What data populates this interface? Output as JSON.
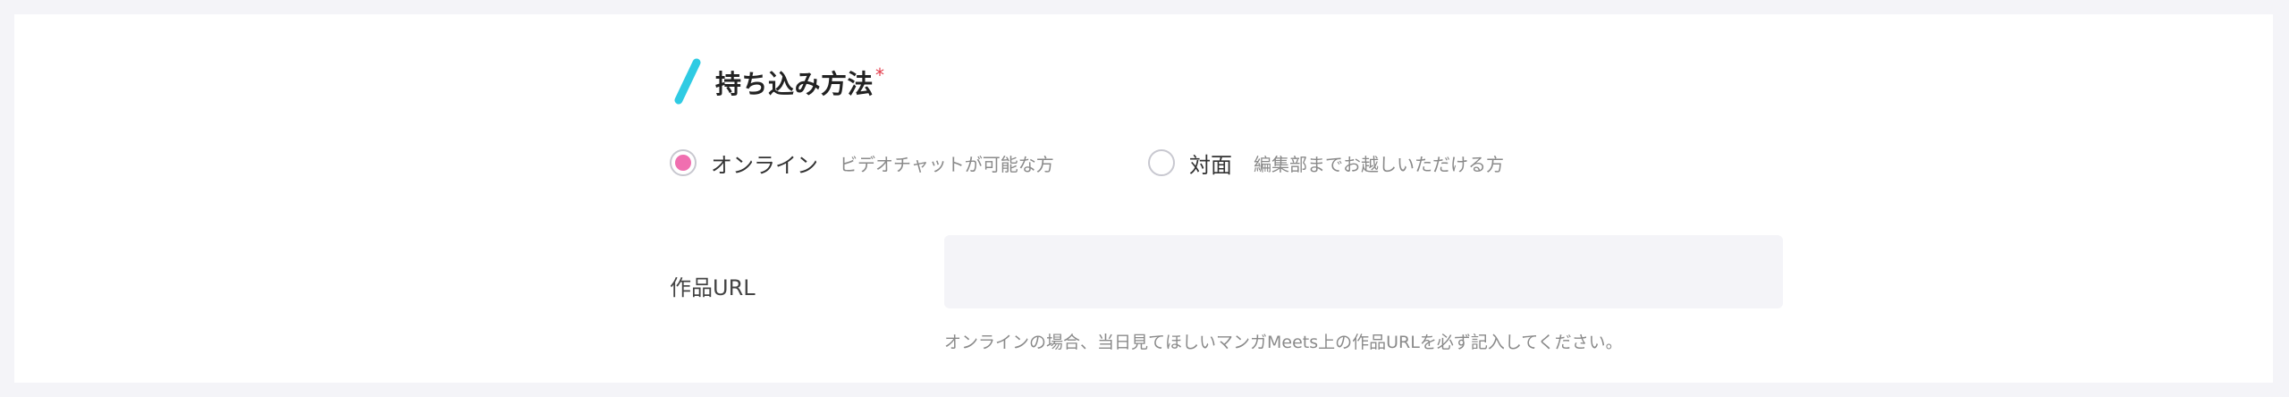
{
  "section": {
    "title": "持ち込み方法",
    "required_mark": "*",
    "accent_color": "#2fcbe3",
    "required_color": "#e23b4a"
  },
  "delivery_method": {
    "options": [
      {
        "label": "オンライン",
        "description": "ビデオチャットが可能な方",
        "selected": true
      },
      {
        "label": "対面",
        "description": "編集部までお越しいただける方",
        "selected": false
      }
    ],
    "selected_color": "#f06fb0"
  },
  "work_url": {
    "label": "作品URL",
    "value": "",
    "placeholder": "",
    "help": "オンラインの場合、当日見てほしいマンガMeets上の作品URLを必ず記入してください。"
  }
}
